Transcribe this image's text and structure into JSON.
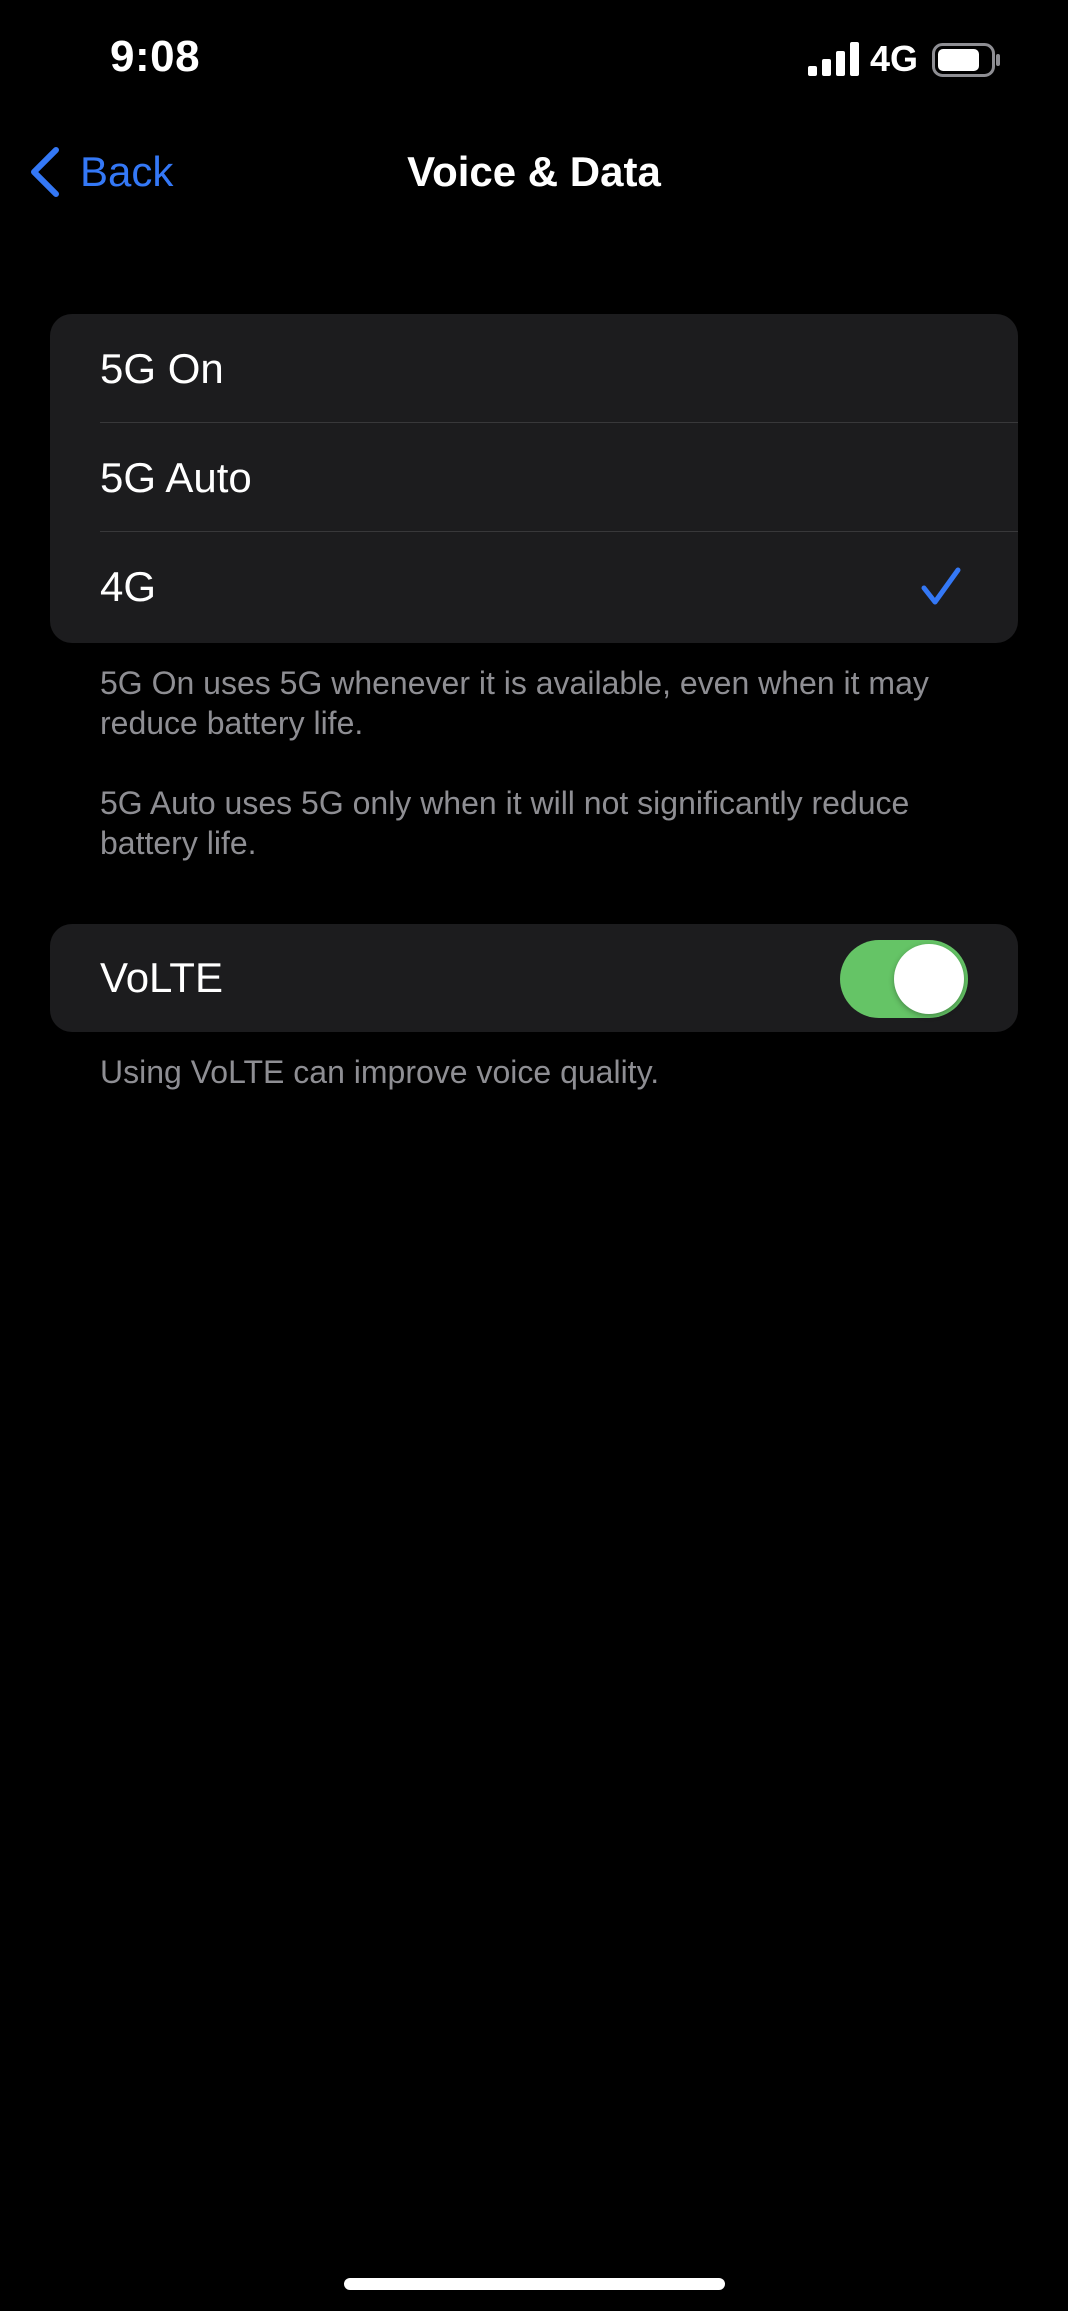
{
  "status_bar": {
    "time": "9:08",
    "network": "4G",
    "signal_icon": "cellular-signal-icon",
    "battery_icon": "battery-icon",
    "battery_level": 0.8
  },
  "nav": {
    "back_label": "Back",
    "title": "Voice & Data"
  },
  "mode_options": [
    {
      "label": "5G On",
      "selected": false
    },
    {
      "label": "5G Auto",
      "selected": false
    },
    {
      "label": "4G",
      "selected": true
    }
  ],
  "mode_footer": {
    "line1": "5G On uses 5G whenever it is available, even when it may reduce battery life.",
    "line2": "5G Auto uses 5G only when it will not significantly reduce battery life."
  },
  "volte": {
    "label": "VoLTE",
    "enabled": true,
    "footer": "Using VoLTE can improve voice quality."
  },
  "colors": {
    "accent": "#3478f6",
    "toggle_on": "#65c466",
    "group_bg": "#1c1c1e",
    "footer_text": "#8e8e93"
  }
}
